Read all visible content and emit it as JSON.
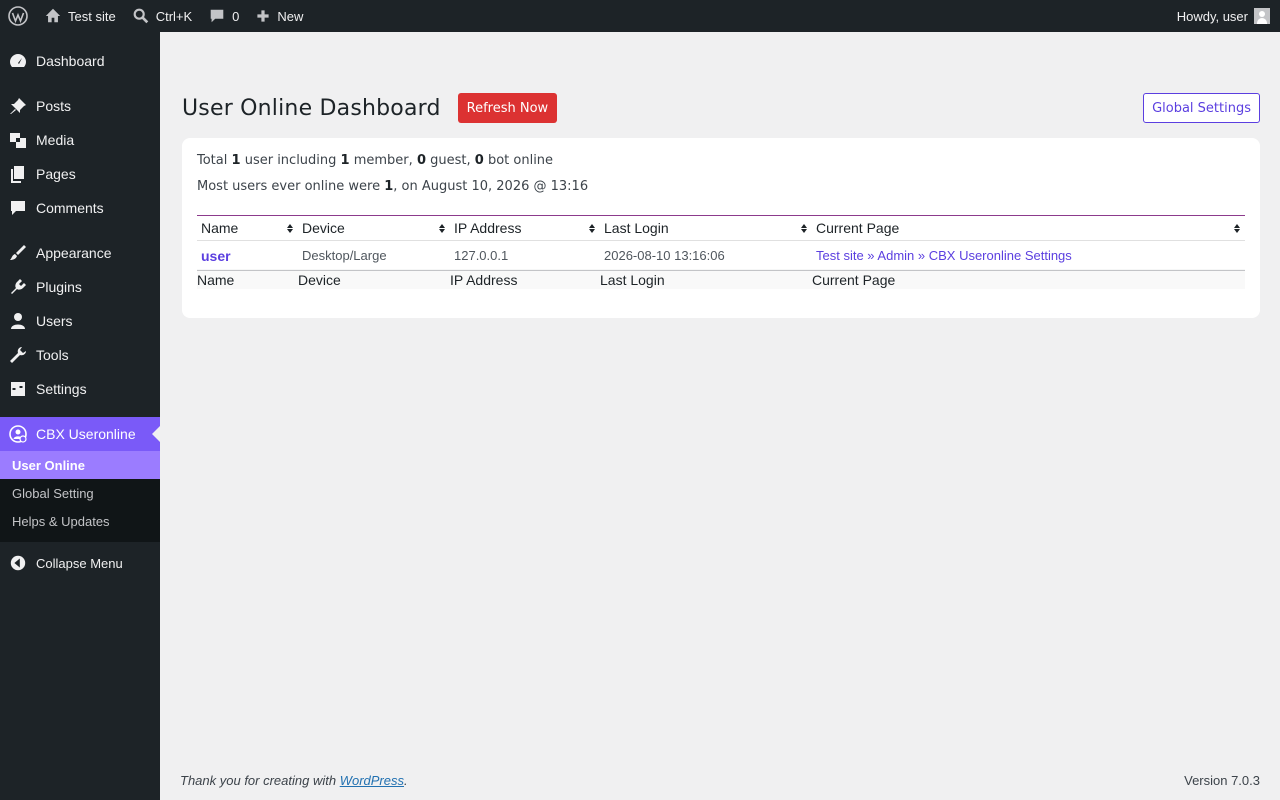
{
  "adminbar": {
    "site_name": "Test site",
    "search_shortcut": "Ctrl+K",
    "comments_count": "0",
    "new_label": "New",
    "howdy": "Howdy, user"
  },
  "sidebar": {
    "items": [
      {
        "label": "Dashboard",
        "icon": "dashboard-icon"
      },
      {
        "label": "Posts",
        "icon": "pin-icon"
      },
      {
        "label": "Media",
        "icon": "media-icon"
      },
      {
        "label": "Pages",
        "icon": "pages-icon"
      },
      {
        "label": "Comments",
        "icon": "comment-icon"
      },
      {
        "label": "Appearance",
        "icon": "brush-icon"
      },
      {
        "label": "Plugins",
        "icon": "plug-icon"
      },
      {
        "label": "Users",
        "icon": "user-icon"
      },
      {
        "label": "Tools",
        "icon": "wrench-icon"
      },
      {
        "label": "Settings",
        "icon": "sliders-icon"
      },
      {
        "label": "CBX Useronline",
        "icon": "user-online-icon"
      }
    ],
    "submenu": [
      "User Online",
      "Global Setting",
      "Helps & Updates"
    ],
    "collapse_label": "Collapse Menu"
  },
  "main": {
    "title": "User Online Dashboard",
    "refresh_label": "Refresh Now",
    "global_settings_label": "Global Settings",
    "stats": {
      "total_prefix": "Total",
      "total": "1",
      "total_mid": "user including",
      "members": "1",
      "members_label": "member,",
      "guests": "0",
      "guests_label": "guest,",
      "bots": "0",
      "bots_label": "bot online",
      "most_prefix": "Most users ever online were",
      "most_count": "1",
      "most_suffix": ", on August 10, 2026 @ 13:16"
    },
    "table": {
      "columns": [
        "Name",
        "Device",
        "IP Address",
        "Last Login",
        "Current Page"
      ],
      "rows": [
        {
          "name": "user",
          "device": "Desktop/Large",
          "ip": "127.0.0.1",
          "last_login": "2026-08-10 13:16:06",
          "current_page": "Test site » Admin » CBX Useronline Settings"
        }
      ]
    }
  },
  "footer": {
    "thanks_prefix": "Thank you for creating with",
    "thanks_link": "WordPress",
    "thanks_suffix": ".",
    "version": "Version 7.0.3"
  },
  "colors": {
    "accent": "#7a5af8",
    "refresh": "#dc3232",
    "link": "#5b3fe0"
  }
}
